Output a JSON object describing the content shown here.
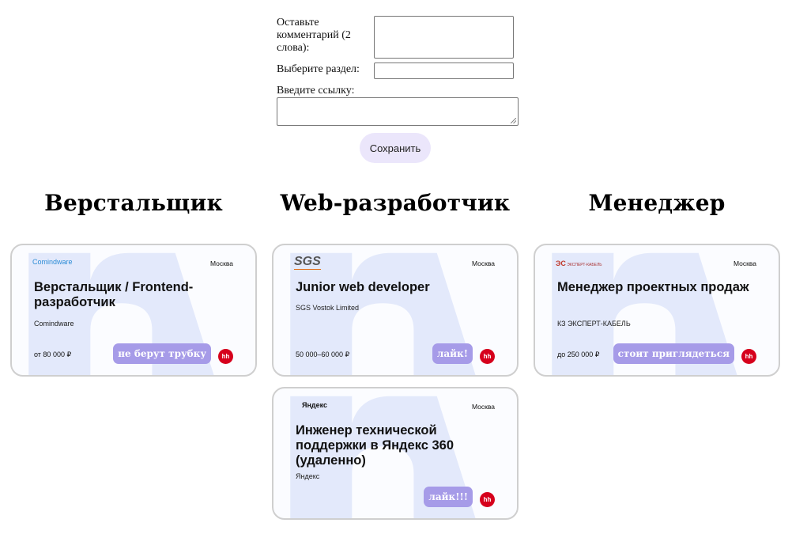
{
  "form": {
    "comment_label": "Оставьте комментарий (2 слова):",
    "section_label": "Выберите раздел:",
    "link_label": "Введите ссылку:",
    "comment_value": "",
    "section_value": "",
    "link_value": "",
    "save_label": "Сохранить"
  },
  "columns": [
    {
      "title": "Верстальщик"
    },
    {
      "title": "Web-разработчик"
    },
    {
      "title": "Менеджер"
    }
  ],
  "cards": [
    {
      "logo": "Comindware",
      "city": "Москва",
      "title": "Верстальщик / Frontend-разработчик",
      "company": "Comindware",
      "salary": "от 80 000 ₽",
      "note": "не берут трубку",
      "badge": "hh"
    },
    {
      "logo": "SGS",
      "city": "Москва",
      "title": "Junior web developer",
      "company": "SGS Vostok Limited",
      "salary": "50 000–60 000 ₽",
      "note": "лайк!",
      "badge": "hh"
    },
    {
      "logo": "ЭКСПЕРТ-КАБЕЛЬ",
      "city": "Москва",
      "title": "Менеджер проектных продаж",
      "company": "КЗ ЭКСПЕРТ-КАБЕЛЬ",
      "salary": "до 250 000 ₽",
      "note": "стоит приглядеться",
      "badge": "hh"
    },
    {
      "logo": "Яндекс",
      "city": "Москва",
      "title": "Инженер технической поддержки в Яндекс 360 (удаленно)",
      "company": "Яндекс",
      "salary": "",
      "note": "лайк!!!",
      "badge": "hh"
    }
  ],
  "colors": {
    "note_bg": "#a69be8",
    "hh_red": "#d6001c",
    "button_bg": "#ebe6fb",
    "card_bg_shape": "#e3e9fb"
  }
}
